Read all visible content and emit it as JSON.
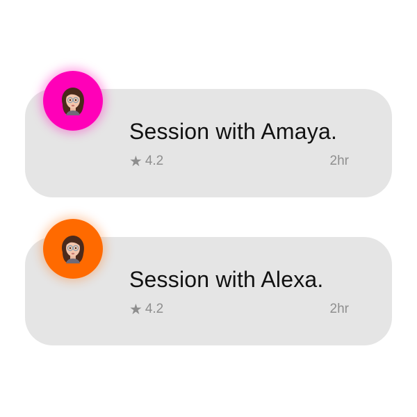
{
  "sessions": [
    {
      "title": "Session with Amaya.",
      "rating": "4.2",
      "duration": "2hr",
      "avatar_color": "#ff00b8",
      "avatar_glow": "rgba(255,0,184,0.35)",
      "avatar_icon": "memoji-avatar-icon"
    },
    {
      "title": "Session with Alexa.",
      "rating": "4.2",
      "duration": "2hr",
      "avatar_color": "#ff6a00",
      "avatar_glow": "rgba(255,106,0,0.30)",
      "avatar_icon": "memoji-avatar-icon"
    }
  ],
  "rating_icon": "star-icon",
  "card_color": "#e5e5e5"
}
